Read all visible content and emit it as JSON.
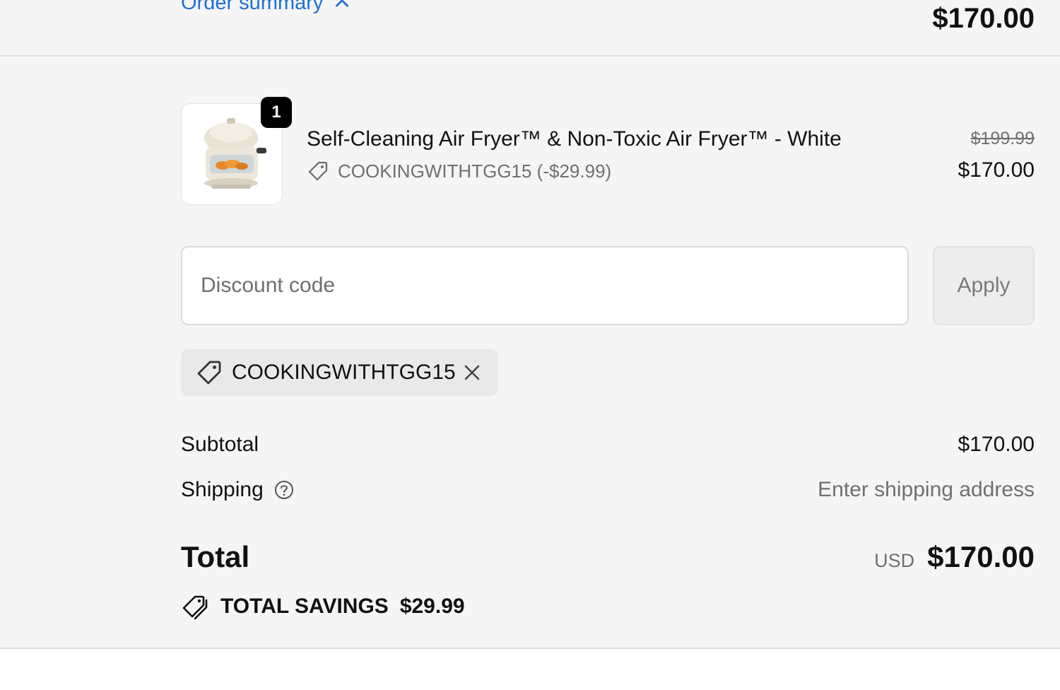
{
  "summary": {
    "toggle_label": "Order summary",
    "total": "$170.00"
  },
  "line_item": {
    "quantity": "1",
    "title": "Self-Cleaning Air Fryer™ & Non-Toxic Air Fryer™ - White",
    "discount": "COOKINGWITHTGG15 (-$29.99)",
    "original_price": "$199.99",
    "price": "$170.00",
    "image_icon": "air-fryer-product-image"
  },
  "discount": {
    "placeholder": "Discount code",
    "value": "",
    "apply_label": "Apply",
    "applied_code": "COOKINGWITHTGG15"
  },
  "totals": {
    "subtotal_label": "Subtotal",
    "subtotal_value": "$170.00",
    "shipping_label": "Shipping",
    "shipping_value": "Enter shipping address",
    "total_label": "Total",
    "currency": "USD",
    "total_value": "$170.00",
    "savings_label": "TOTAL SAVINGS",
    "savings_value": "$29.99"
  },
  "colors": {
    "link": "#1f6fd1",
    "panel_bg": "#f5f5f5",
    "muted_text": "#707070"
  }
}
